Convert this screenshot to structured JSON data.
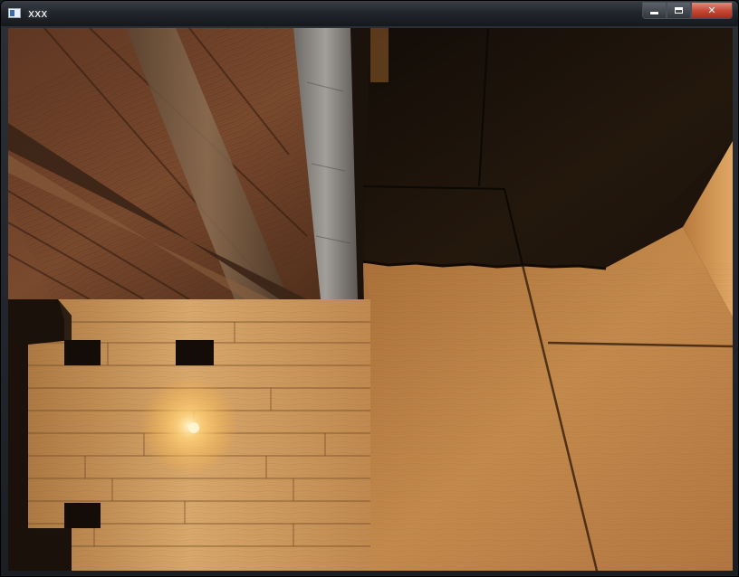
{
  "window": {
    "title": "xxx",
    "icon": "app-window-icon",
    "buttons": {
      "minimize": "minimize-icon",
      "maximize": "maximize-icon",
      "close": "close-icon",
      "close_glyph": "✕"
    }
  },
  "scene": {
    "colors": {
      "floor_tile": "#c48a4c",
      "shadow": "#1e140b",
      "wood_ceiling": "#6e4128",
      "pine_panel": "#d0a066",
      "stone_pillar": "#8a8680",
      "lamp_glow": "#ffd27a"
    }
  }
}
